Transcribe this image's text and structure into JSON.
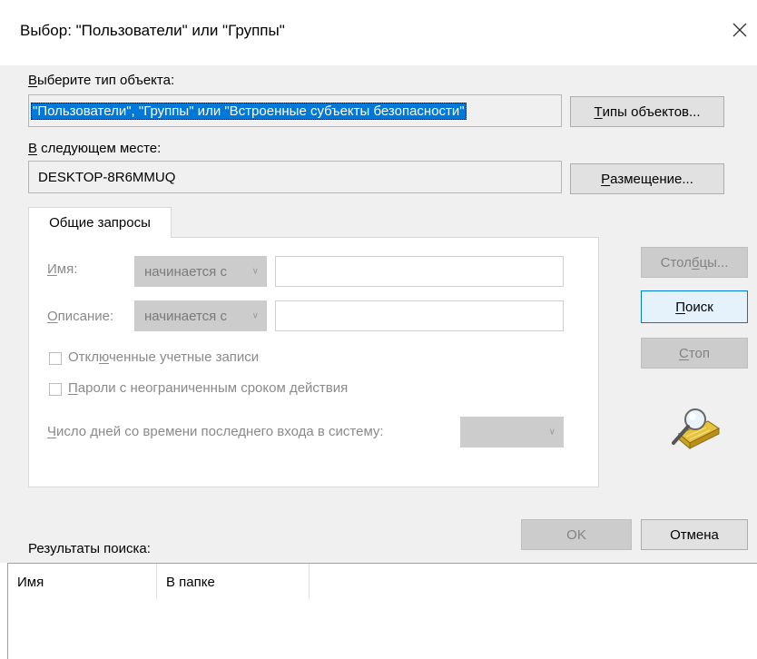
{
  "window": {
    "title": "Выбор: \"Пользователи\" или \"Группы\""
  },
  "object_type": {
    "label_prefix": "В",
    "label_rest": "ыберите тип объекта:",
    "value": "\"Пользователи\", \"Группы\" или \"Встроенные субъекты безопасности\"",
    "button_prefix": "Т",
    "button_rest": "ипы объектов..."
  },
  "location": {
    "label_prefix": "В",
    "label_rest": " следующем месте:",
    "value": "DESKTOP-8R6MMUQ",
    "button_prefix": "Р",
    "button_rest": "азмещение..."
  },
  "tab": {
    "label": "Общие запросы"
  },
  "query": {
    "name_label_prefix": "И",
    "name_label_rest": "мя:",
    "name_condition": "начинается с",
    "desc_label_prefix": "О",
    "desc_label_rest": "писание:",
    "desc_condition": "начинается с",
    "disabled_accounts_prefix": "Откл",
    "disabled_accounts_ul": "ю",
    "disabled_accounts_rest": "ченные учетные записи",
    "non_expiring_prefix": "",
    "non_expiring_ul": "П",
    "non_expiring_rest": "ароли с неограниченным сроком действия",
    "days_label_prefix": "Ч",
    "days_label_rest": "исло дней со времени последнего входа в систему:"
  },
  "side_buttons": {
    "columns_prefix": "Стол",
    "columns_ul": "б",
    "columns_rest": "цы...",
    "search_prefix": "",
    "search_ul": "П",
    "search_rest": "оиск",
    "stop_prefix": "",
    "stop_ul": "С",
    "stop_rest": "топ"
  },
  "footer": {
    "ok": "OK",
    "cancel": "Отмена",
    "results_label": "Результаты поиска:"
  },
  "results": {
    "columns": [
      "Имя",
      "В папке"
    ]
  },
  "icons": {
    "close": "close-icon",
    "search_graphic": "magnifier-search-icon"
  }
}
